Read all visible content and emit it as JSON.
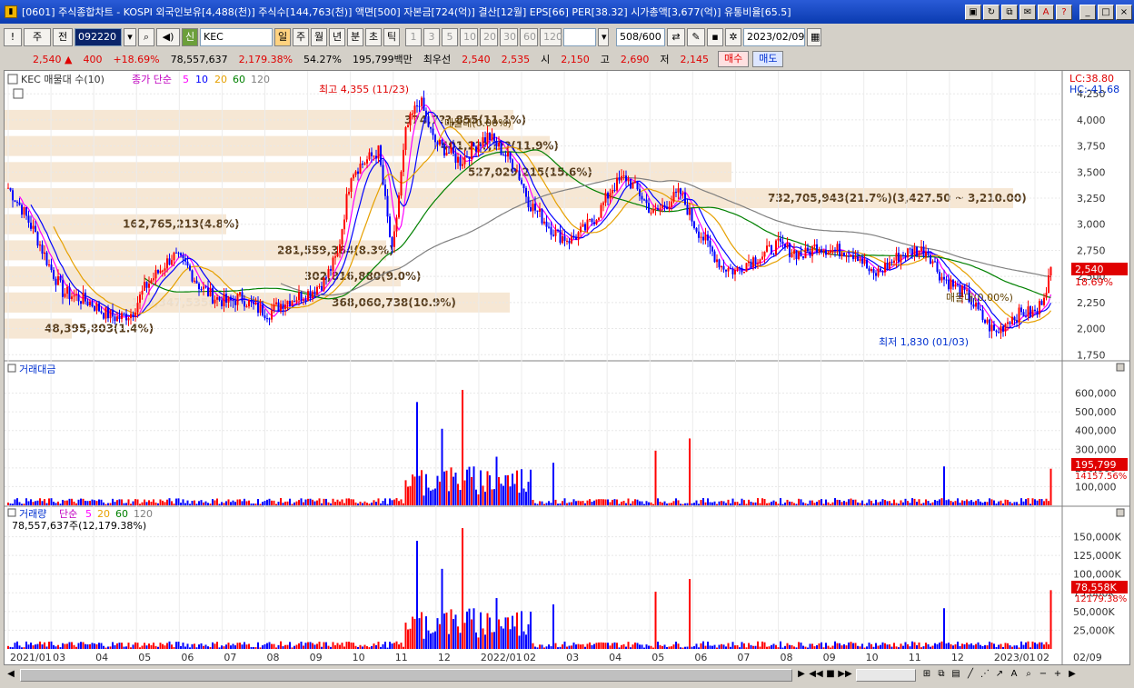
{
  "window": {
    "title": "[0601] 주식종합차트 - KOSPI 외국인보유[4,488(천)] 주식수[144,763(천)] 액면[500] 자본금[724(억)] 결산[12월] EPS[66] PER[38.32] 시가총액[3,677(억)] 유통비율[65.5]",
    "buttons": [
      "▣",
      "↻",
      "⧉",
      "✉",
      "A",
      "?",
      "_",
      "□",
      "×"
    ]
  },
  "toolbar": {
    "mode": "주",
    "prev": "전",
    "code": "092220",
    "market": "신",
    "name": "KEC",
    "periods": [
      "일",
      "주",
      "월",
      "년",
      "분",
      "초",
      "틱"
    ],
    "intervals": [
      "1",
      "3",
      "5",
      "10",
      "20",
      "30",
      "60",
      "120"
    ],
    "count": "508",
    "count_max": "/600",
    "date": "2023/02/09"
  },
  "quote": {
    "price": "2,540 ▲",
    "change": "400",
    "pct": "+18.69%",
    "volume": "78,557,637",
    "vol_ratio": "2,179.38%",
    "turnover": "54.27%",
    "amount": "195,799백만",
    "best_label": "최우선",
    "best_ask": "2,540",
    "best_bid": "2,535",
    "open_label": "시",
    "open": "2,150",
    "high_label": "고",
    "high": "2,690",
    "low_label": "저",
    "low": "2,145",
    "buy": "매수",
    "sell": "매도"
  },
  "legend": {
    "main": "KEC 매물대 수(10)",
    "ma_label": "종가 단순",
    "ma": [
      "5",
      "10",
      "20",
      "60",
      "120"
    ],
    "ma_colors": [
      "#ff00ff",
      "#0000ff",
      "#e6a000",
      "#008000",
      "#808080"
    ],
    "amount_title": "거래대금",
    "volume_title": "거래량",
    "volume_ma_label": "단순",
    "volume_info": "78,557,637주(12,179.38%)"
  },
  "annotations": {
    "high": "최고 4,355 (11/23)",
    "low": "최저 1,830 (01/03)",
    "lc": "LC:38.80",
    "hc": "HC:-41.68",
    "last_price": "2,540",
    "last_pct": "18.69%",
    "last_amount": "195,799",
    "last_amount_pct": "14157.56%",
    "last_volume": "78,558K",
    "last_volume_pct": "12179.38%"
  },
  "volume_profile": [
    {
      "label": "48,395,803(1.4%)",
      "price": 2000
    },
    {
      "label": "175,347,535(5.2%)",
      "price": 2250
    },
    {
      "label": "162,765,213(4.8%)",
      "price": 3000
    },
    {
      "label": "281,559,364(8.3%)",
      "price": 2750
    },
    {
      "label": "302,816,880(9.0%)",
      "price": 2500
    },
    {
      "label": "368,060,738(10.9%)",
      "price": 2250
    },
    {
      "label": "374,7??,855(11.1%)",
      "price": 4000
    },
    {
      "label": "401,2??,???(11.9%)",
      "price": 3750
    },
    {
      "label": "527,029,215(15.6%)",
      "price": 3500
    },
    {
      "label": "732,705,943(21.7%)(3,427.50 ~ 3,210.00)",
      "price": 3250
    }
  ],
  "profile_notes": {
    "top": "매물대(0.00%)",
    "bottom": "매물대(0.00%)"
  },
  "chart_data": [
    {
      "type": "candlestick",
      "title": "KEC",
      "y_ticks": [
        "4,250",
        "4,000",
        "3,750",
        "3,500",
        "3,250",
        "3,000",
        "2,750",
        "2,500",
        "2,250",
        "2,000",
        "1,750"
      ],
      "ylim": [
        1700,
        4400
      ],
      "x_ticks": [
        "2021/01",
        "03",
        "04",
        "05",
        "06",
        "07",
        "08",
        "09",
        "10",
        "11",
        "12",
        "2022/01",
        "02",
        "03",
        "04",
        "05",
        "06",
        "07",
        "08",
        "09",
        "10",
        "11",
        "12",
        "2023/01",
        "02",
        "02/09"
      ],
      "closes": [
        3350,
        3150,
        2900,
        2600,
        2350,
        2300,
        2250,
        2150,
        2100,
        2150,
        2400,
        2550,
        2700,
        2600,
        2400,
        2300,
        2250,
        2300,
        2200,
        2150,
        2250,
        2300,
        2350,
        2450,
        2700,
        3500,
        3600,
        3700,
        2700,
        3900,
        4200,
        3800,
        3700,
        3600,
        3750,
        3850,
        3700,
        3550,
        3200,
        3050,
        2900,
        2850,
        2950,
        3100,
        3350,
        3450,
        3300,
        3100,
        3200,
        3300,
        3000,
        2800,
        2600,
        2550,
        2650,
        2700,
        2800,
        2750,
        2700,
        2800,
        2750,
        2750,
        2700,
        2500,
        2600,
        2700,
        2750,
        2750,
        2500,
        2400,
        2300,
        2100,
        1950,
        2100,
        2150,
        2150,
        2540
      ],
      "high": 4355,
      "low": 1830
    },
    {
      "type": "bar",
      "title": "거래대금",
      "y_ticks": [
        "600,000",
        "500,000",
        "400,000",
        "300,000",
        "200,000",
        "100,000"
      ],
      "ylim": [
        0,
        700000
      ],
      "last_value": 195799
    },
    {
      "type": "bar",
      "title": "거래량",
      "y_ticks": [
        "150,000K",
        "125,000K",
        "100,000K",
        "75,000K",
        "50,000K",
        "25,000K"
      ],
      "ylim": [
        0,
        175000
      ],
      "last_value": 78558
    }
  ]
}
